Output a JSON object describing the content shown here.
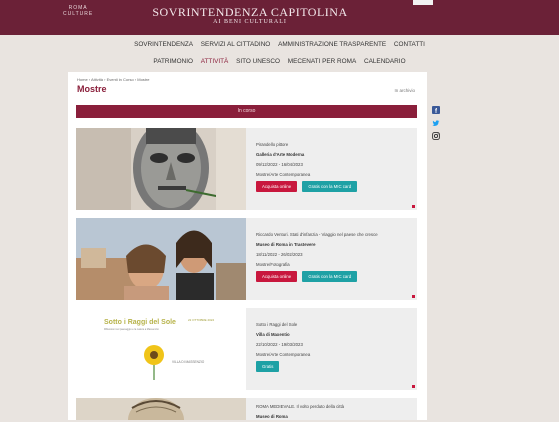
{
  "header": {
    "logo_line1": "ROMA",
    "logo_line2": "CULTURE",
    "title_line1": "SOVRINTENDENZA CAPITOLINA",
    "title_line2": "AI BENI CULTURALI"
  },
  "nav_primary": [
    "SOVRINTENDENZA",
    "SERVIZI AL CITTADINO",
    "AMMINISTRAZIONE TRASPARENTE",
    "CONTATTI"
  ],
  "nav_secondary": [
    "PATRIMONIO",
    "ATTIVITÀ",
    "SITO UNESCO",
    "MECENATI PER ROMA",
    "CALENDARIO"
  ],
  "page": {
    "breadcrumb": "Home › Attività › Eventi in Corso › Mostre",
    "title": "Mostre",
    "archive_link": "In archivio",
    "section_label": "In corso"
  },
  "cards": [
    {
      "subtitle": "Pirandello pittore",
      "venue": "Galleria d'Arte Moderna",
      "dates": "09/12/2022 - 16/04/2023",
      "category": "Mostre/Arte Contemporanea",
      "buttons": [
        "Acquista online",
        "Gratis con la MIC card"
      ]
    },
    {
      "subtitle": "Riccardo Venturi. Stati d'infanzia - Viaggio nel paese che cresce",
      "venue": "Museo di Roma in Trastevere",
      "dates": "18/11/2022 - 26/02/2023",
      "category": "Mostre/Fotografia",
      "buttons": [
        "Acquista online",
        "Gratis con la MIC card"
      ]
    },
    {
      "subtitle": "Sotto i Raggi del Sole",
      "venue": "Villa di Maxentio",
      "dates": "22/10/2022 - 19/03/2023",
      "category": "Mostre/Arte Contemporanea",
      "buttons": [
        "Gratis"
      ]
    },
    {
      "subtitle": "ROMA MEDIEVALE. Il volto perduto della città",
      "venue": "Museo di Roma",
      "dates": "",
      "category": "",
      "buttons": []
    }
  ],
  "card3_image_text": {
    "title": "Sotto i Raggi del Sole",
    "subtitle": "Riflessioni sul paesaggio e la natura a Massenzio",
    "date": "22 OTTOBRE 2022",
    "venue": "VILLA DI MASSENZIO"
  },
  "social": [
    "facebook-icon",
    "twitter-icon",
    "instagram-icon"
  ],
  "colors": {
    "brand": "#6b2137",
    "accent": "#8a1f3b",
    "buy": "#c8173d",
    "mic": "#1ea1a5"
  }
}
